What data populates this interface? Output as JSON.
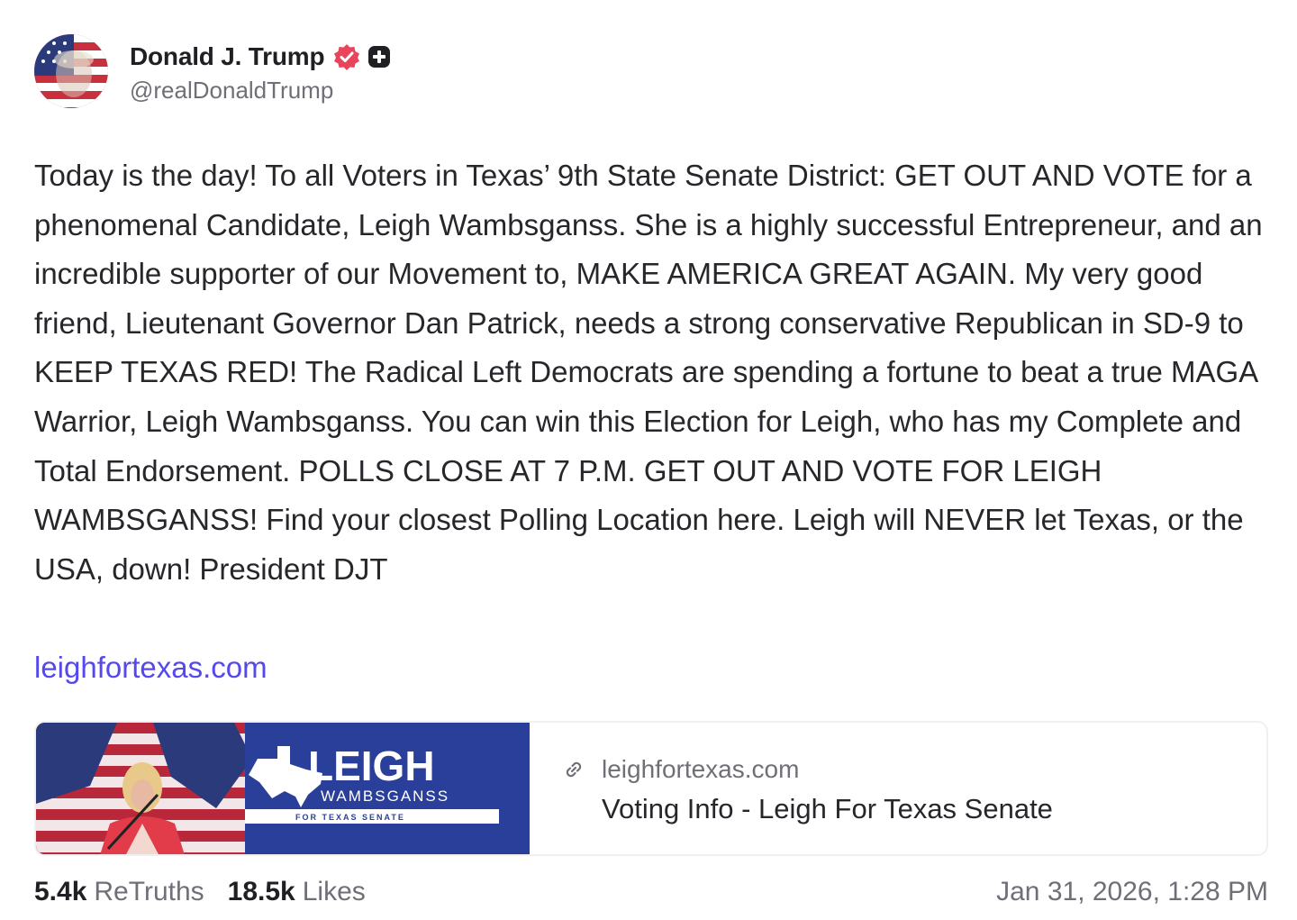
{
  "author": {
    "display_name": "Donald J. Trump",
    "handle": "@realDonaldTrump",
    "avatar_icon": "flag-face-avatar",
    "verified_icon": "verified-badge-icon",
    "plus_icon": "plus-badge-icon"
  },
  "post": {
    "text": "Today is the day! To all Voters in Texas’ 9th State Senate District: GET OUT AND VOTE for a phenomenal Candidate, Leigh Wambsganss. She is a highly successful Entrepreneur, and an incredible supporter of our Movement to, MAKE AMERICA GREAT AGAIN. My very good friend, Lieutenant Governor Dan Patrick, needs a strong conservative Republican in SD-9 to KEEP TEXAS RED! The Radical Left Democrats are spending a fortune to beat a true MAGA Warrior, Leigh Wambsganss. You can win this Election for Leigh, who has my Complete and Total Endorsement. POLLS CLOSE AT 7 P.M. GET OUT AND VOTE FOR LEIGH WAMBSGANSS! Find your closest Polling Location here. Leigh will NEVER let Texas, or the USA, down! President DJT",
    "link": "leighfortexas.com"
  },
  "link_card": {
    "banner_name": "LEIGH",
    "banner_surname": "WAMBSGANSS",
    "banner_subtitle": "FOR TEXAS SENATE",
    "domain": "leighfortexas.com",
    "title": "Voting Info - Leigh For Texas Senate",
    "link_icon": "link-icon"
  },
  "stats": {
    "retruths_count": "5.4k",
    "retruths_label": "ReTruths",
    "likes_count": "18.5k",
    "likes_label": "Likes"
  },
  "timestamp": "Jan 31, 2026, 1:28 PM",
  "colors": {
    "link": "#5448ee",
    "verified": "#e8455d",
    "banner_blue": "#2a3f9a",
    "text": "#26262b",
    "muted": "#6f6f78"
  }
}
